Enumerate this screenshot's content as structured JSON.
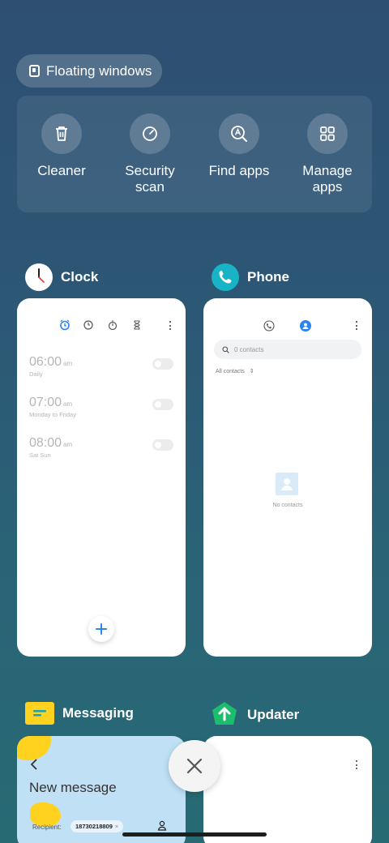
{
  "floating": {
    "label": "Floating windows"
  },
  "tools": [
    {
      "label": "Cleaner",
      "icon": "trash-icon"
    },
    {
      "label": "Security\nscan",
      "icon": "security-scan-icon"
    },
    {
      "label": "Find apps",
      "icon": "find-apps-icon"
    },
    {
      "label": "Manage\napps",
      "icon": "grid-icon"
    }
  ],
  "apps": {
    "clock": {
      "name": "Clock",
      "alarms": [
        {
          "time": "06:00",
          "ampm": "am",
          "repeat": "Daily"
        },
        {
          "time": "07:00",
          "ampm": "am",
          "repeat": "Monday to Friday"
        },
        {
          "time": "08:00",
          "ampm": "am",
          "repeat": "Sat Sun"
        }
      ]
    },
    "phone": {
      "name": "Phone",
      "search_placeholder": "0 contacts",
      "filter": "All contacts",
      "empty_text": "No contacts"
    },
    "messaging": {
      "name": "Messaging",
      "title": "New message",
      "recipient_label": "Recipient:",
      "recipient_value": "18730218809"
    },
    "updater": {
      "name": "Updater"
    }
  },
  "colors": {
    "accent_blue": "#2b84f0",
    "phone_teal": "#19b3c6",
    "messaging_yellow": "#ffd21f",
    "updater_green": "#1dbd6e"
  }
}
